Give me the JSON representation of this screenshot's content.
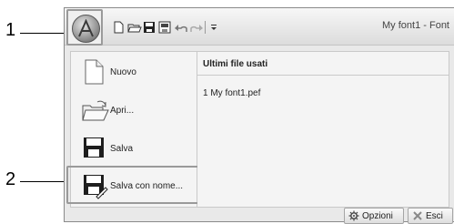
{
  "callouts": {
    "one": "1",
    "two": "2"
  },
  "window": {
    "title": "My font1 - Font"
  },
  "menu": {
    "items": [
      {
        "label": "Nuovo"
      },
      {
        "label": "Apri..."
      },
      {
        "label": "Salva"
      },
      {
        "label": "Salva con nome..."
      }
    ],
    "recent_header": "Ultimi file usati",
    "recent_files": [
      "1 My font1.pef"
    ]
  },
  "bottom": {
    "options_label": "Opzioni",
    "exit_label": "Esci"
  }
}
